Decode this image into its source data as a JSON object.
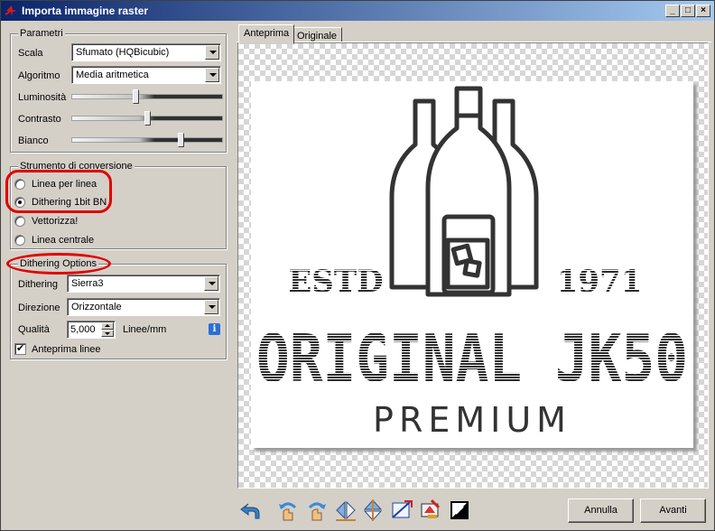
{
  "window": {
    "title": "Importa immagine raster",
    "minimize_glyph": "_",
    "maximize_glyph": "□",
    "close_glyph": "×"
  },
  "parametri": {
    "title": "Parametri",
    "scala": {
      "label": "Scala",
      "value": "Sfumato (HQBicubic)"
    },
    "algoritmo": {
      "label": "Algoritmo",
      "value": "Media aritmetica"
    },
    "luminosita": {
      "label": "Luminosità",
      "level": 0.42
    },
    "contrasto": {
      "label": "Contrasto",
      "level": 0.5
    },
    "bianco": {
      "label": "Bianco",
      "level": 0.73
    }
  },
  "strumento": {
    "title": "Strumento di conversione",
    "options": [
      {
        "label": "Linea per linea",
        "selected": false
      },
      {
        "label": "Dithering 1bit BN",
        "selected": true
      },
      {
        "label": "Vettorizza!",
        "selected": false
      },
      {
        "label": "Linea centrale",
        "selected": false
      }
    ]
  },
  "dithering": {
    "title": "Dithering Options",
    "dithering": {
      "label": "Dithering",
      "value": "Sierra3"
    },
    "direzione": {
      "label": "Direzione",
      "value": "Orizzontale"
    },
    "qualita": {
      "label": "Qualità",
      "value": "5,000",
      "unit": "Linee/mm"
    },
    "anteprima": {
      "label": "Anteprima linee",
      "checked": true
    }
  },
  "tabs": [
    {
      "label": "Anteprima",
      "active": true
    },
    {
      "label": "Originale",
      "active": false
    }
  ],
  "logo": {
    "estd": "ESTD",
    "year": "1971",
    "brand": "ORIGINAL JK50",
    "sub": "PREMIUM"
  },
  "buttons": {
    "annulla": "Annulla",
    "avanti": "Avanti"
  },
  "colors": {
    "annotation_red": "#e00000",
    "title_blue": "#0a246a"
  }
}
